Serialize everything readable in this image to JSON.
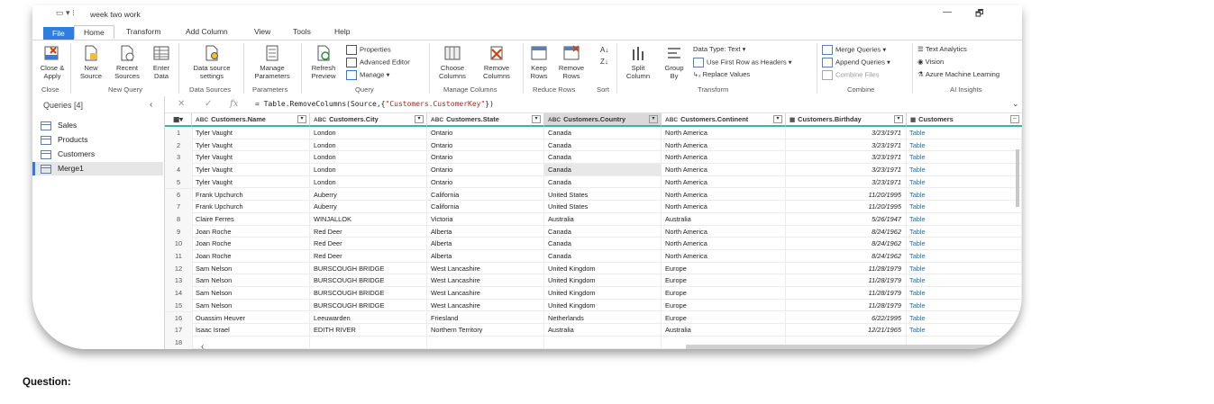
{
  "window": {
    "title": "week two work",
    "minimize": "—",
    "restore": "🗗"
  },
  "tabs": [
    "File",
    "Home",
    "Transform",
    "Add Column",
    "View",
    "Tools",
    "Help"
  ],
  "ribbon": {
    "close_apply": "Close &\nApply",
    "new_source": "New\nSource",
    "recent_sources": "Recent\nSources",
    "enter_data": "Enter\nData",
    "data_source_settings": "Data source\nsettings",
    "manage_parameters": "Manage\nParameters",
    "refresh_preview": "Refresh\nPreview",
    "properties": "Properties",
    "advanced_editor": "Advanced Editor",
    "manage": "Manage",
    "choose_columns": "Choose\nColumns",
    "remove_columns": "Remove\nColumns",
    "keep_rows": "Keep\nRows",
    "remove_rows": "Remove\nRows",
    "split_column": "Split\nColumn",
    "group_by": "Group\nBy",
    "data_type": "Data Type: Text",
    "first_row_headers": "Use First Row as Headers",
    "replace_values": "Replace Values",
    "merge_queries": "Merge Queries",
    "append_queries": "Append Queries",
    "combine_files": "Combine Files",
    "text_analytics": "Text Analytics",
    "vision": "Vision",
    "azure_ml": "Azure Machine Learning",
    "groups": [
      "Close",
      "New Query",
      "Data Sources",
      "Parameters",
      "Query",
      "Manage Columns",
      "Reduce Rows",
      "Sort",
      "Transform",
      "Combine",
      "AI Insights"
    ]
  },
  "queries": {
    "header": "Queries [4]",
    "items": [
      "Sales",
      "Products",
      "Customers",
      "Merge1"
    ],
    "selected": "Merge1"
  },
  "formula": {
    "prefix": "= Table.RemoveColumns(Source,{",
    "string": "\"Customers.CustomerKey\"",
    "suffix": "})"
  },
  "columns": [
    "Customers.Name",
    "Customers.City",
    "Customers.State",
    "Customers.Country",
    "Customers.Continent",
    "Customers.Birthday",
    "Customers"
  ],
  "rows": [
    [
      "1",
      "Tyler Vaught",
      "London",
      "Ontario",
      "Canada",
      "North America",
      "3/23/1971",
      "Table"
    ],
    [
      "2",
      "Tyler Vaught",
      "London",
      "Ontario",
      "Canada",
      "North America",
      "3/23/1971",
      "Table"
    ],
    [
      "3",
      "Tyler Vaught",
      "London",
      "Ontario",
      "Canada",
      "North America",
      "3/23/1971",
      "Table"
    ],
    [
      "4",
      "Tyler Vaught",
      "London",
      "Ontario",
      "Canada",
      "North America",
      "3/23/1971",
      "Table"
    ],
    [
      "5",
      "Tyler Vaught",
      "London",
      "Ontario",
      "Canada",
      "North America",
      "3/23/1971",
      "Table"
    ],
    [
      "6",
      "Frank Upchurch",
      "Auberry",
      "California",
      "United States",
      "North America",
      "11/20/1995",
      "Table"
    ],
    [
      "7",
      "Frank Upchurch",
      "Auberry",
      "California",
      "United States",
      "North America",
      "11/20/1995",
      "Table"
    ],
    [
      "8",
      "Claire Ferres",
      "WINJALLOK",
      "Victoria",
      "Australia",
      "Australia",
      "5/26/1947",
      "Table"
    ],
    [
      "9",
      "Joan Roche",
      "Red Deer",
      "Alberta",
      "Canada",
      "North America",
      "8/24/1962",
      "Table"
    ],
    [
      "10",
      "Joan Roche",
      "Red Deer",
      "Alberta",
      "Canada",
      "North America",
      "8/24/1962",
      "Table"
    ],
    [
      "11",
      "Joan Roche",
      "Red Deer",
      "Alberta",
      "Canada",
      "North America",
      "8/24/1962",
      "Table"
    ],
    [
      "12",
      "Sam Nelson",
      "BURSCOUGH BRIDGE",
      "West Lancashire",
      "United Kingdom",
      "Europe",
      "11/28/1979",
      "Table"
    ],
    [
      "13",
      "Sam Nelson",
      "BURSCOUGH BRIDGE",
      "West Lancashire",
      "United Kingdom",
      "Europe",
      "11/28/1979",
      "Table"
    ],
    [
      "14",
      "Sam Nelson",
      "BURSCOUGH BRIDGE",
      "West Lancashire",
      "United Kingdom",
      "Europe",
      "11/28/1979",
      "Table"
    ],
    [
      "15",
      "Sam Nelson",
      "BURSCOUGH BRIDGE",
      "West Lancashire",
      "United Kingdom",
      "Europe",
      "11/28/1979",
      "Table"
    ],
    [
      "16",
      "Ouassim Heuver",
      "Leeuwarden",
      "Friesland",
      "Netherlands",
      "Europe",
      "6/22/1995",
      "Table"
    ],
    [
      "17",
      "Isaac Israel",
      "EDITH RIVER",
      "Northern Territory",
      "Australia",
      "Australia",
      "12/21/1965",
      "Table"
    ],
    [
      "18",
      "",
      "",
      "",
      "",
      "",
      "",
      ""
    ]
  ],
  "question_label": "Question:",
  "colors": {
    "accent": "#2f7de1",
    "header_rule": "#3db3a4",
    "link": "#1a6fc7"
  }
}
